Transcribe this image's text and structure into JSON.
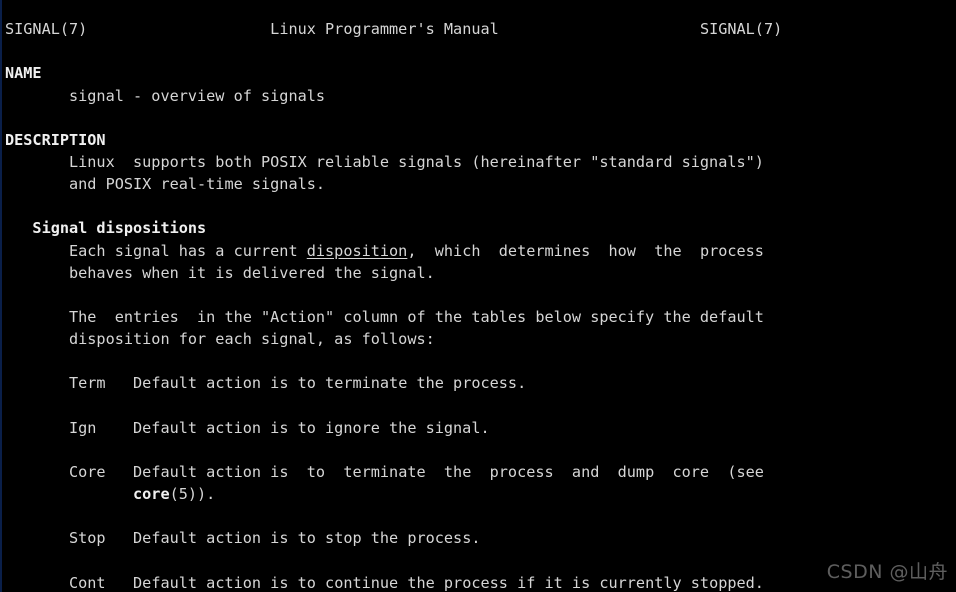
{
  "terminal": {
    "background_color": "#000000",
    "foreground_color": "#d6d6d6",
    "bold_color": "#f0f0f0"
  },
  "header": {
    "left": "SIGNAL(7)",
    "center": "Linux Programmer's Manual",
    "right": "SIGNAL(7)"
  },
  "sections": {
    "name": {
      "heading": "NAME",
      "body_line_1": "       signal - overview of signals"
    },
    "description": {
      "heading": "DESCRIPTION",
      "body_line_1": "       Linux  supports both POSIX reliable signals (hereinafter \"standard signals\")",
      "body_line_2": "       and POSIX real-time signals."
    },
    "signal_dispositions": {
      "heading": "   Signal dispositions",
      "para1_line1_pre": "       Each signal has a current ",
      "para1_link": "disposition",
      "para1_line1_post": ",  which  determines  how  the  process",
      "para1_line2": "       behaves when it is delivered the signal.",
      "para2_line1": "       The  entries  in the \"Action\" column of the tables below specify the default",
      "para2_line2": "       disposition for each signal, as follows:",
      "entries": [
        {
          "label": "       Term",
          "gap": "   ",
          "text": "Default action is to terminate the process."
        },
        {
          "label": "       Ign",
          "gap": "    ",
          "text": "Default action is to ignore the signal."
        },
        {
          "label": "       Core",
          "gap": "   ",
          "text": "Default action is  to  terminate  the  process  and  dump  core  (see",
          "cont_indent": "              ",
          "cont_bold": "core",
          "cont_rest": "(5))."
        },
        {
          "label": "       Stop",
          "gap": "   ",
          "text": "Default action is to stop the process."
        },
        {
          "label": "       Cont",
          "gap": "   ",
          "text": "Default action is to continue the process if it is currently stopped."
        }
      ]
    }
  },
  "watermark": {
    "text": "CSDN @山舟"
  }
}
